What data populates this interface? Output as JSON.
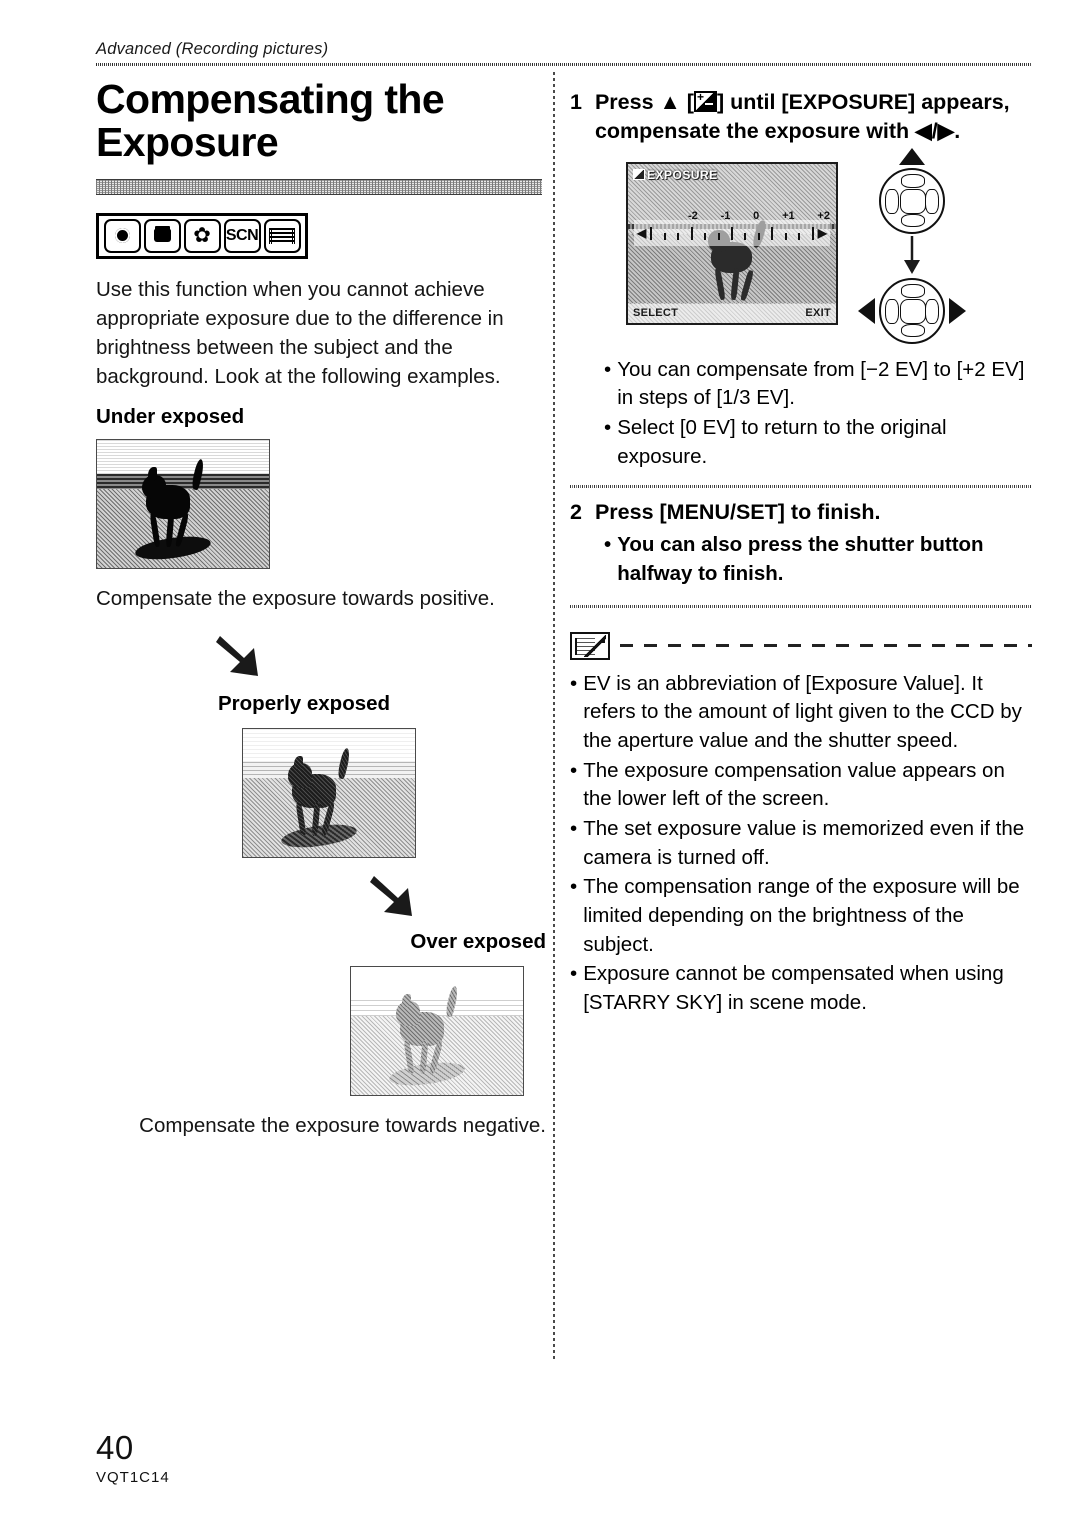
{
  "header": {
    "running_head": "Advanced (Recording pictures)"
  },
  "left_column": {
    "title": "Compensating the Exposure",
    "mode_icons": [
      {
        "name": "record-mode-icon",
        "label": "REC"
      },
      {
        "name": "portrait-mode-icon",
        "label": "PORTRAIT"
      },
      {
        "name": "macro-mode-icon",
        "label": "✿"
      },
      {
        "name": "scene-mode-icon",
        "label": "SCN"
      },
      {
        "name": "motion-picture-mode-icon",
        "label": "MOVIE"
      }
    ],
    "intro": "Use this function when you cannot achieve appropriate exposure due to the difference in brightness between the subject and the background. Look at the following examples.",
    "under_exposed_label": "Under exposed",
    "under_exposed_caption": "Compensate the exposure towards positive.",
    "properly_exposed_label": "Properly exposed",
    "over_exposed_label": "Over exposed",
    "over_exposed_caption": "Compensate the exposure towards negative."
  },
  "right_column": {
    "step1": {
      "number": "1",
      "text_before_icon": "Press ▲ [",
      "text_after_icon": "] until [EXPOSURE] appears, compensate the exposure with ◀/▶."
    },
    "lcd": {
      "title": "EXPOSURE",
      "scale_values": [
        "-2",
        "-1",
        "0",
        "+1",
        "+2"
      ],
      "left_arrow": "◀",
      "right_arrow": "▶",
      "select_label": "SELECT",
      "exit_label": "EXIT"
    },
    "step1_bullets": [
      "You can compensate from [−2 EV] to [+2 EV] in steps of [1/3 EV].",
      "Select [0 EV] to return to the original exposure."
    ],
    "step2": {
      "number": "2",
      "text": "Press [MENU/SET] to finish.",
      "bullets": [
        "You can also press the shutter button halfway to finish."
      ]
    },
    "note_bullets": [
      "EV is an abbreviation of [Exposure Value]. It refers to the amount of light given to the CCD by the aperture value and the shutter speed.",
      "The exposure compensation value appears on the lower left of the screen.",
      "The set exposure value is memorized even if the camera is turned off.",
      "The compensation range of the exposure will be limited depending on the brightness of the subject.",
      "Exposure cannot be compensated when using [STARRY SKY] in scene mode."
    ]
  },
  "footer": {
    "page_number": "40",
    "doc_code": "VQT1C14"
  },
  "bullet_glyph": "•"
}
